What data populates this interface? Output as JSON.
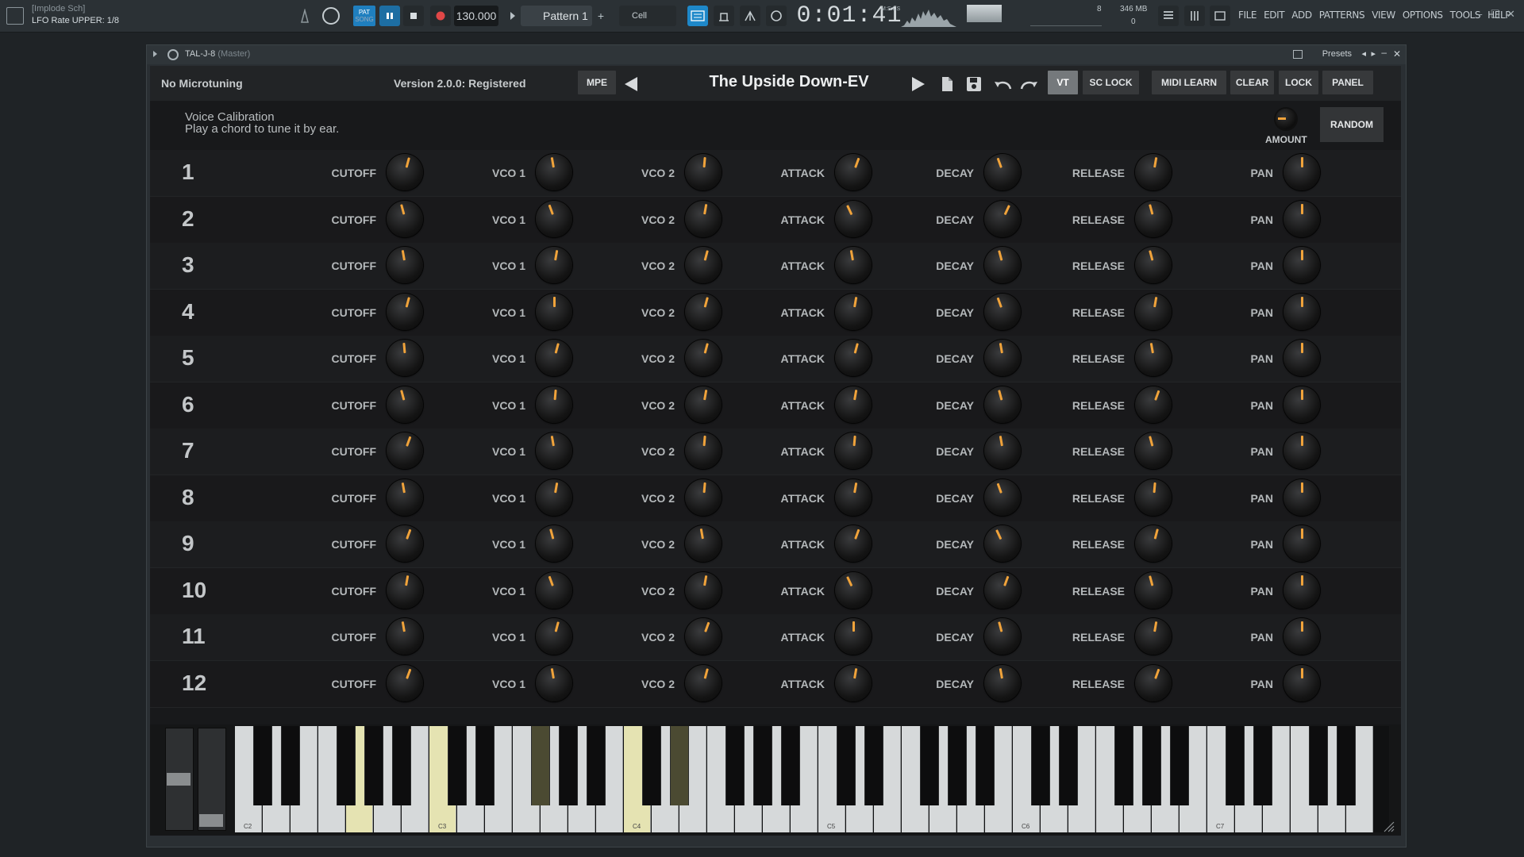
{
  "topbar": {
    "hint_title": "[Implode Sch]",
    "hint_text": "LFO Rate UPPER: 1/8",
    "pat_label": "PAT",
    "song_label": "SONG",
    "tempo": "130.000",
    "pattern": "Pattern 1",
    "snap": "Cell",
    "time": "0:01:41",
    "time_unit": "M:S:CS",
    "mem_mb": "346 MB",
    "mem_count": "8",
    "mem_zero": "0",
    "menu": [
      "FILE",
      "EDIT",
      "ADD",
      "PATTERNS",
      "VIEW",
      "OPTIONS",
      "TOOLS",
      "HELP"
    ]
  },
  "plugin_window": {
    "title": "TAL-J-8",
    "title_suffix": "(Master)",
    "presets_label": "Presets"
  },
  "synth": {
    "microtuning": "No Microtuning",
    "version": "Version 2.0.0: Registered",
    "mpe": "MPE",
    "preset_name": "The Upside Down-EV",
    "buttons": {
      "vt": "VT",
      "sc_lock": "SC LOCK",
      "midi_learn": "MIDI LEARN",
      "clear": "CLEAR",
      "lock": "LOCK",
      "panel": "PANEL"
    },
    "calibration_title": "Voice Calibration",
    "calibration_hint": "Play a chord to tune it by ear.",
    "amount_label": "AMOUNT",
    "random": "RANDOM",
    "param_labels": [
      "CUTOFF",
      "VCO 1",
      "VCO 2",
      "ATTACK",
      "DECAY",
      "RELEASE",
      "PAN"
    ],
    "voices": [
      {
        "num": "1",
        "knobs": [
          15,
          -10,
          5,
          20,
          -20,
          10,
          0
        ]
      },
      {
        "num": "2",
        "knobs": [
          -15,
          -20,
          10,
          -25,
          25,
          -15,
          0
        ]
      },
      {
        "num": "3",
        "knobs": [
          -10,
          10,
          15,
          -10,
          -15,
          -15,
          0
        ]
      },
      {
        "num": "4",
        "knobs": [
          15,
          0,
          15,
          10,
          -20,
          10,
          0
        ]
      },
      {
        "num": "5",
        "knobs": [
          -5,
          15,
          15,
          15,
          -10,
          -10,
          0
        ]
      },
      {
        "num": "6",
        "knobs": [
          -15,
          5,
          10,
          10,
          -15,
          20,
          0
        ]
      },
      {
        "num": "7",
        "knobs": [
          20,
          -10,
          5,
          5,
          -10,
          -15,
          0
        ]
      },
      {
        "num": "8",
        "knobs": [
          -10,
          10,
          5,
          10,
          -20,
          5,
          0
        ]
      },
      {
        "num": "9",
        "knobs": [
          20,
          -15,
          -10,
          20,
          -25,
          15,
          0
        ]
      },
      {
        "num": "10",
        "knobs": [
          10,
          -20,
          10,
          -25,
          20,
          -15,
          0
        ]
      },
      {
        "num": "11",
        "knobs": [
          -10,
          15,
          20,
          0,
          -15,
          10,
          0
        ]
      },
      {
        "num": "12",
        "knobs": [
          20,
          -10,
          15,
          10,
          -10,
          20,
          0
        ]
      }
    ],
    "octave_labels": [
      "C2",
      "C3",
      "C4",
      "C5",
      "C6",
      "C7"
    ],
    "mod_wheel_value": 0.45,
    "pitch_wheel_value": 0.0
  },
  "colors": {
    "knob_indicator": "#f0a33b",
    "highlight_key": "#e5e3b2"
  }
}
